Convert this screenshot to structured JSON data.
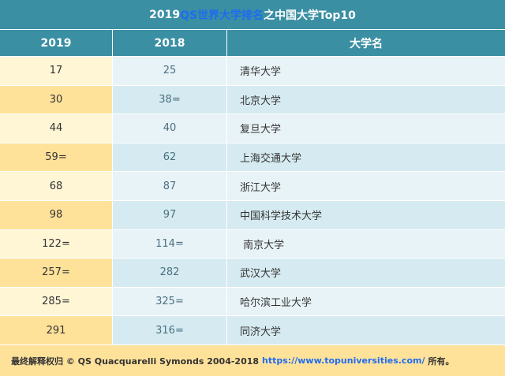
{
  "title": {
    "prefix": "2019 ",
    "highlight": "QS世界大学排名",
    "suffix": "之中国大学Top10"
  },
  "headers": [
    "2019",
    "2018",
    "大学名"
  ],
  "rows": [
    {
      "r2019": "17",
      "r2018": "25",
      "name": "清华大学"
    },
    {
      "r2019": "30",
      "r2018": "38=",
      "name": "北京大学"
    },
    {
      "r2019": "44",
      "r2018": "40",
      "name": "复旦大学"
    },
    {
      "r2019": "59=",
      "r2018": "62",
      "name": "上海交通大学"
    },
    {
      "r2019": "68",
      "r2018": "87",
      "name": "浙江大学"
    },
    {
      "r2019": "98",
      "r2018": "97",
      "name": "中国科学技术大学"
    },
    {
      "r2019": "122=",
      "r2018": "114=",
      "name": " 南京大学"
    },
    {
      "r2019": "257=",
      "r2018": "282",
      "name": "武汉大学"
    },
    {
      "r2019": "285=",
      "r2018": "325=",
      "name": "哈尔滨工业大学"
    },
    {
      "r2019": "291",
      "r2018": "316=",
      "name": "同济大学"
    }
  ],
  "footer": {
    "text": "最终解释权归 © QS Quacquarelli Symonds 2004-2018",
    "url": "https://www.topuniversities.com/",
    "suffix": "所有。"
  },
  "colors": {
    "header": "#3a8fa3",
    "highlight": "#1e6cf0",
    "yellow_light": "#fff6d6",
    "yellow_dark": "#ffe29a",
    "blue_light": "#e8f3f7",
    "blue_dark": "#d6ebf1"
  }
}
